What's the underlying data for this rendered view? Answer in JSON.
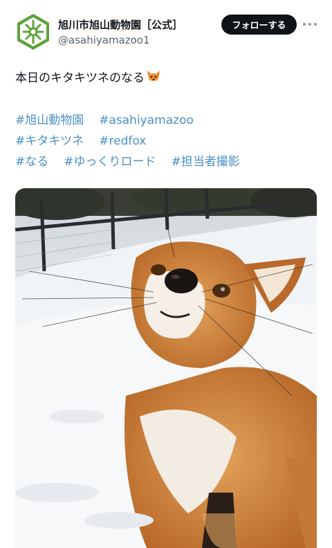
{
  "account": {
    "display_name": "旭川市旭山動物園［公式］",
    "handle": "@asahiyamazoo1",
    "avatar_icon": "zoo-logo-icon",
    "brand_color": "#5ea33a"
  },
  "actions": {
    "follow_label": "フォローする",
    "more_icon": "more-icon"
  },
  "tweet": {
    "text": "本日のキタキツネのなる",
    "emoji": "fox-face-icon",
    "hashtags": [
      [
        "#旭山動物園",
        "#asahiyamazoo"
      ],
      [
        "#キタキツネ",
        "#redfox"
      ],
      [
        "#なる",
        "#ゆっくりロード",
        "#担当者撮影"
      ]
    ]
  },
  "media": {
    "description_icon": "photo-red-fox-in-snow"
  }
}
